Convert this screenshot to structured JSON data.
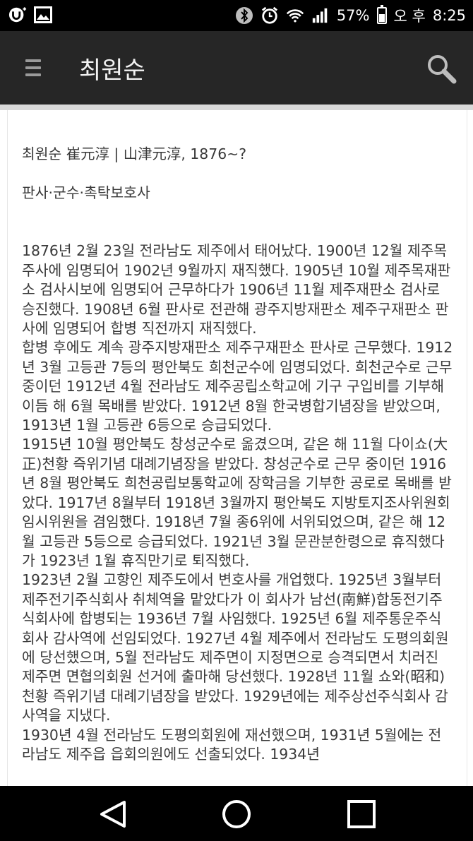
{
  "status_bar": {
    "battery_percent": "57%",
    "ampm": "오 후",
    "time": "8:25"
  },
  "app_bar": {
    "title": "최원순"
  },
  "article": {
    "heading_line1": "최원순 崔元淳 | 山津元淳, 1876~?",
    "heading_line2": "판사·군수·촉탁보호사",
    "paragraphs": [
      "1876년 2월 23일 전라남도 제주에서 태어났다. 1900년 12월 제주목 주사에 임명되어 1902년 9월까지 재직했다. 1905년 10월 제주목재판소 검사시보에 임명되어 근무하다가 1906년 11월 제주재판소 검사로 승진했다. 1908년 6월 판사로 전관해 광주지방재판소 제주구재판소 판사에 임명되어 합병 직전까지 재직했다.",
      "합병 후에도 계속 광주지방재판소 제주구재판소 판사로 근무했다. 1912년 3월 고등관 7등의 평안북도 희천군수에 임명되었다. 희천군수로 근무 중이던 1912년 4월 전라남도 제주공립소학교에 기구 구입비를 기부해 이듬 해 6월 목배를 받았다. 1912년 8월 한국병합기념장을 받았으며, 1913년 1월 고등관 6등으로 승급되었다.",
      "1915년 10월 평안북도 창성군수로 옮겼으며, 같은 해 11월 다이쇼(大正)천황 즉위기념 대례기념장을 받았다. 창성군수로 근무 중이던 1916년 8월 평안북도 희천공립보통학교에 장학금을 기부한 공로로 목배를 받았다. 1917년 8월부터 1918년 3월까지 평안북도 지방토지조사위원회 임시위원을 겸임했다. 1918년 7월 종6위에 서위되었으며, 같은 해 12월 고등관 5등으로 승급되었다. 1921년 3월 문관분한령으로 휴직했다가 1923년 1월 휴직만기로 퇴직했다.",
      "1923년 2월 고향인 제주도에서 변호사를 개업했다. 1925년 3월부터 제주전기주식회사 취체역을 맡았다가 이 회사가 남선(南鮮)합동전기주식회사에 합병되는 1936년 7월 사임했다. 1925년 6월 제주통운주식회사 감사역에 선임되었다. 1927년 4월 제주에서 전라남도 도평의회원에 당선했으며, 5월 전라남도 제주면이 지정면으로 승격되면서 치러진 제주면 면협의회원 선거에 출마해 당선했다. 1928년 11월 쇼와(昭和)천황 즉위기념 대례기념장을 받았다. 1929년에는 제주상선주식회사 감사역을 지냈다.",
      "1930년 4월 전라남도 도평의회원에 재선했으며, 1931년 5월에는 전라남도 제주읍 읍회의원에도 선출되었다. 1934년"
    ]
  }
}
